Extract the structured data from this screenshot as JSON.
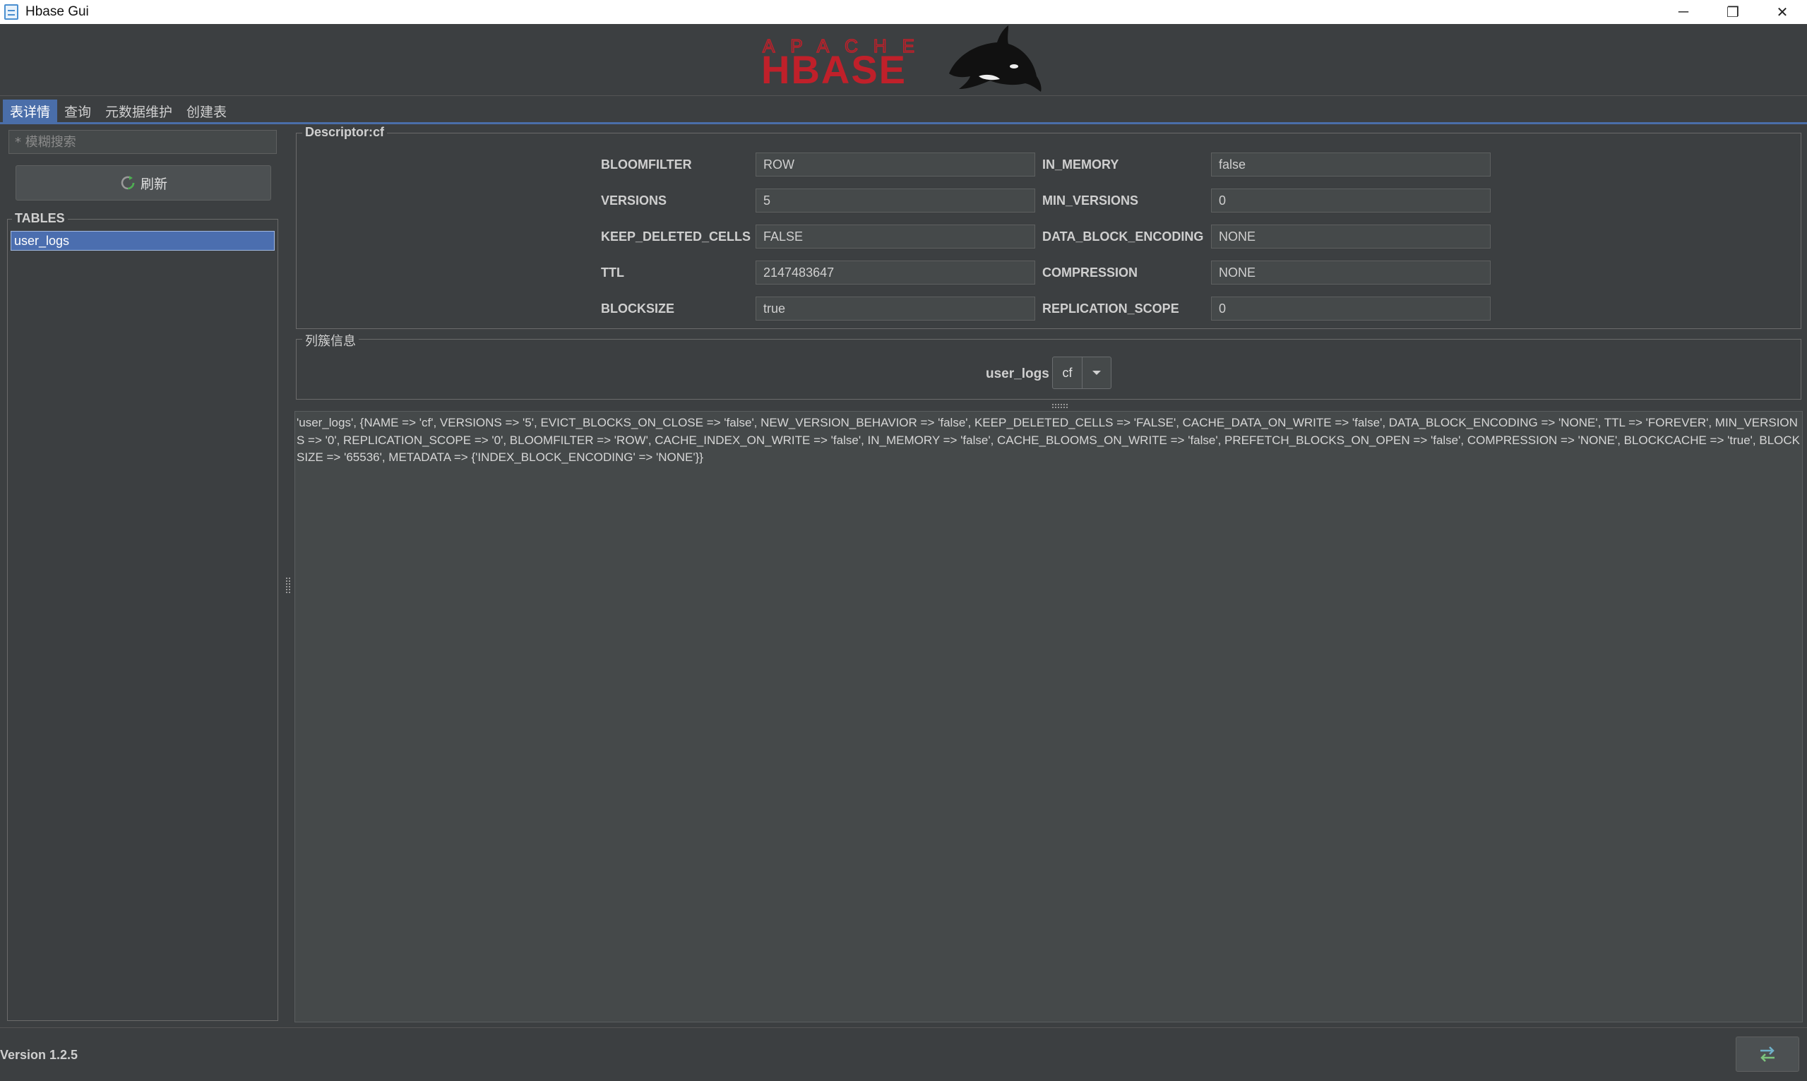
{
  "window": {
    "title": "Hbase Gui",
    "controls": {
      "minimize": "─",
      "restore": "❐",
      "close": "✕"
    }
  },
  "logo": {
    "top_text": "APACHE",
    "main_text": "HBASE",
    "color": "#c0202a"
  },
  "tabs": [
    {
      "label": "表详情",
      "active": true
    },
    {
      "label": "查询",
      "active": false
    },
    {
      "label": "元数据维护",
      "active": false
    },
    {
      "label": "创建表",
      "active": false
    }
  ],
  "sidebar": {
    "search_placeholder": "* 模糊搜索",
    "refresh_label": "刷新",
    "tables_title": "TABLES",
    "tables": [
      {
        "name": "user_logs",
        "selected": true
      }
    ]
  },
  "descriptor": {
    "title": "Descriptor:cf",
    "left": [
      {
        "label": "BLOOMFILTER",
        "value": "ROW"
      },
      {
        "label": "VERSIONS",
        "value": "5"
      },
      {
        "label": "KEEP_DELETED_CELLS",
        "value": "FALSE"
      },
      {
        "label": "TTL",
        "value": "2147483647"
      },
      {
        "label": "BLOCKSIZE",
        "value": "true"
      }
    ],
    "right": [
      {
        "label": "IN_MEMORY",
        "value": "false"
      },
      {
        "label": "MIN_VERSIONS",
        "value": "0"
      },
      {
        "label": "DATA_BLOCK_ENCODING",
        "value": "NONE"
      },
      {
        "label": "COMPRESSION",
        "value": "NONE"
      },
      {
        "label": "REPLICATION_SCOPE",
        "value": "0"
      }
    ]
  },
  "column_family": {
    "title": "列簇信息",
    "table_label": "user_logs",
    "selected": "cf"
  },
  "output_text": "'user_logs', {NAME => 'cf', VERSIONS => '5', EVICT_BLOCKS_ON_CLOSE => 'false', NEW_VERSION_BEHAVIOR => 'false', KEEP_DELETED_CELLS => 'FALSE', CACHE_DATA_ON_WRITE => 'false', DATA_BLOCK_ENCODING => 'NONE', TTL => 'FOREVER', MIN_VERSIONS => '0', REPLICATION_SCOPE => '0', BLOOMFILTER => 'ROW', CACHE_INDEX_ON_WRITE => 'false', IN_MEMORY => 'false', CACHE_BLOOMS_ON_WRITE => 'false', PREFETCH_BLOCKS_ON_OPEN => 'false', COMPRESSION => 'NONE', BLOCKCACHE => 'true', BLOCKSIZE => '65536', METADATA => {'INDEX_BLOCK_ENCODING' => 'NONE'}}",
  "status": {
    "version": "Version 1.2.5"
  },
  "icons": {
    "app": "app-window-icon",
    "refresh": "refresh-icon",
    "dropdown": "chevron-down-icon",
    "switch": "swap-arrows-icon"
  },
  "colors": {
    "accent": "#4a6ea9",
    "selection": "#4b6eaf",
    "background": "#3c3f41"
  }
}
